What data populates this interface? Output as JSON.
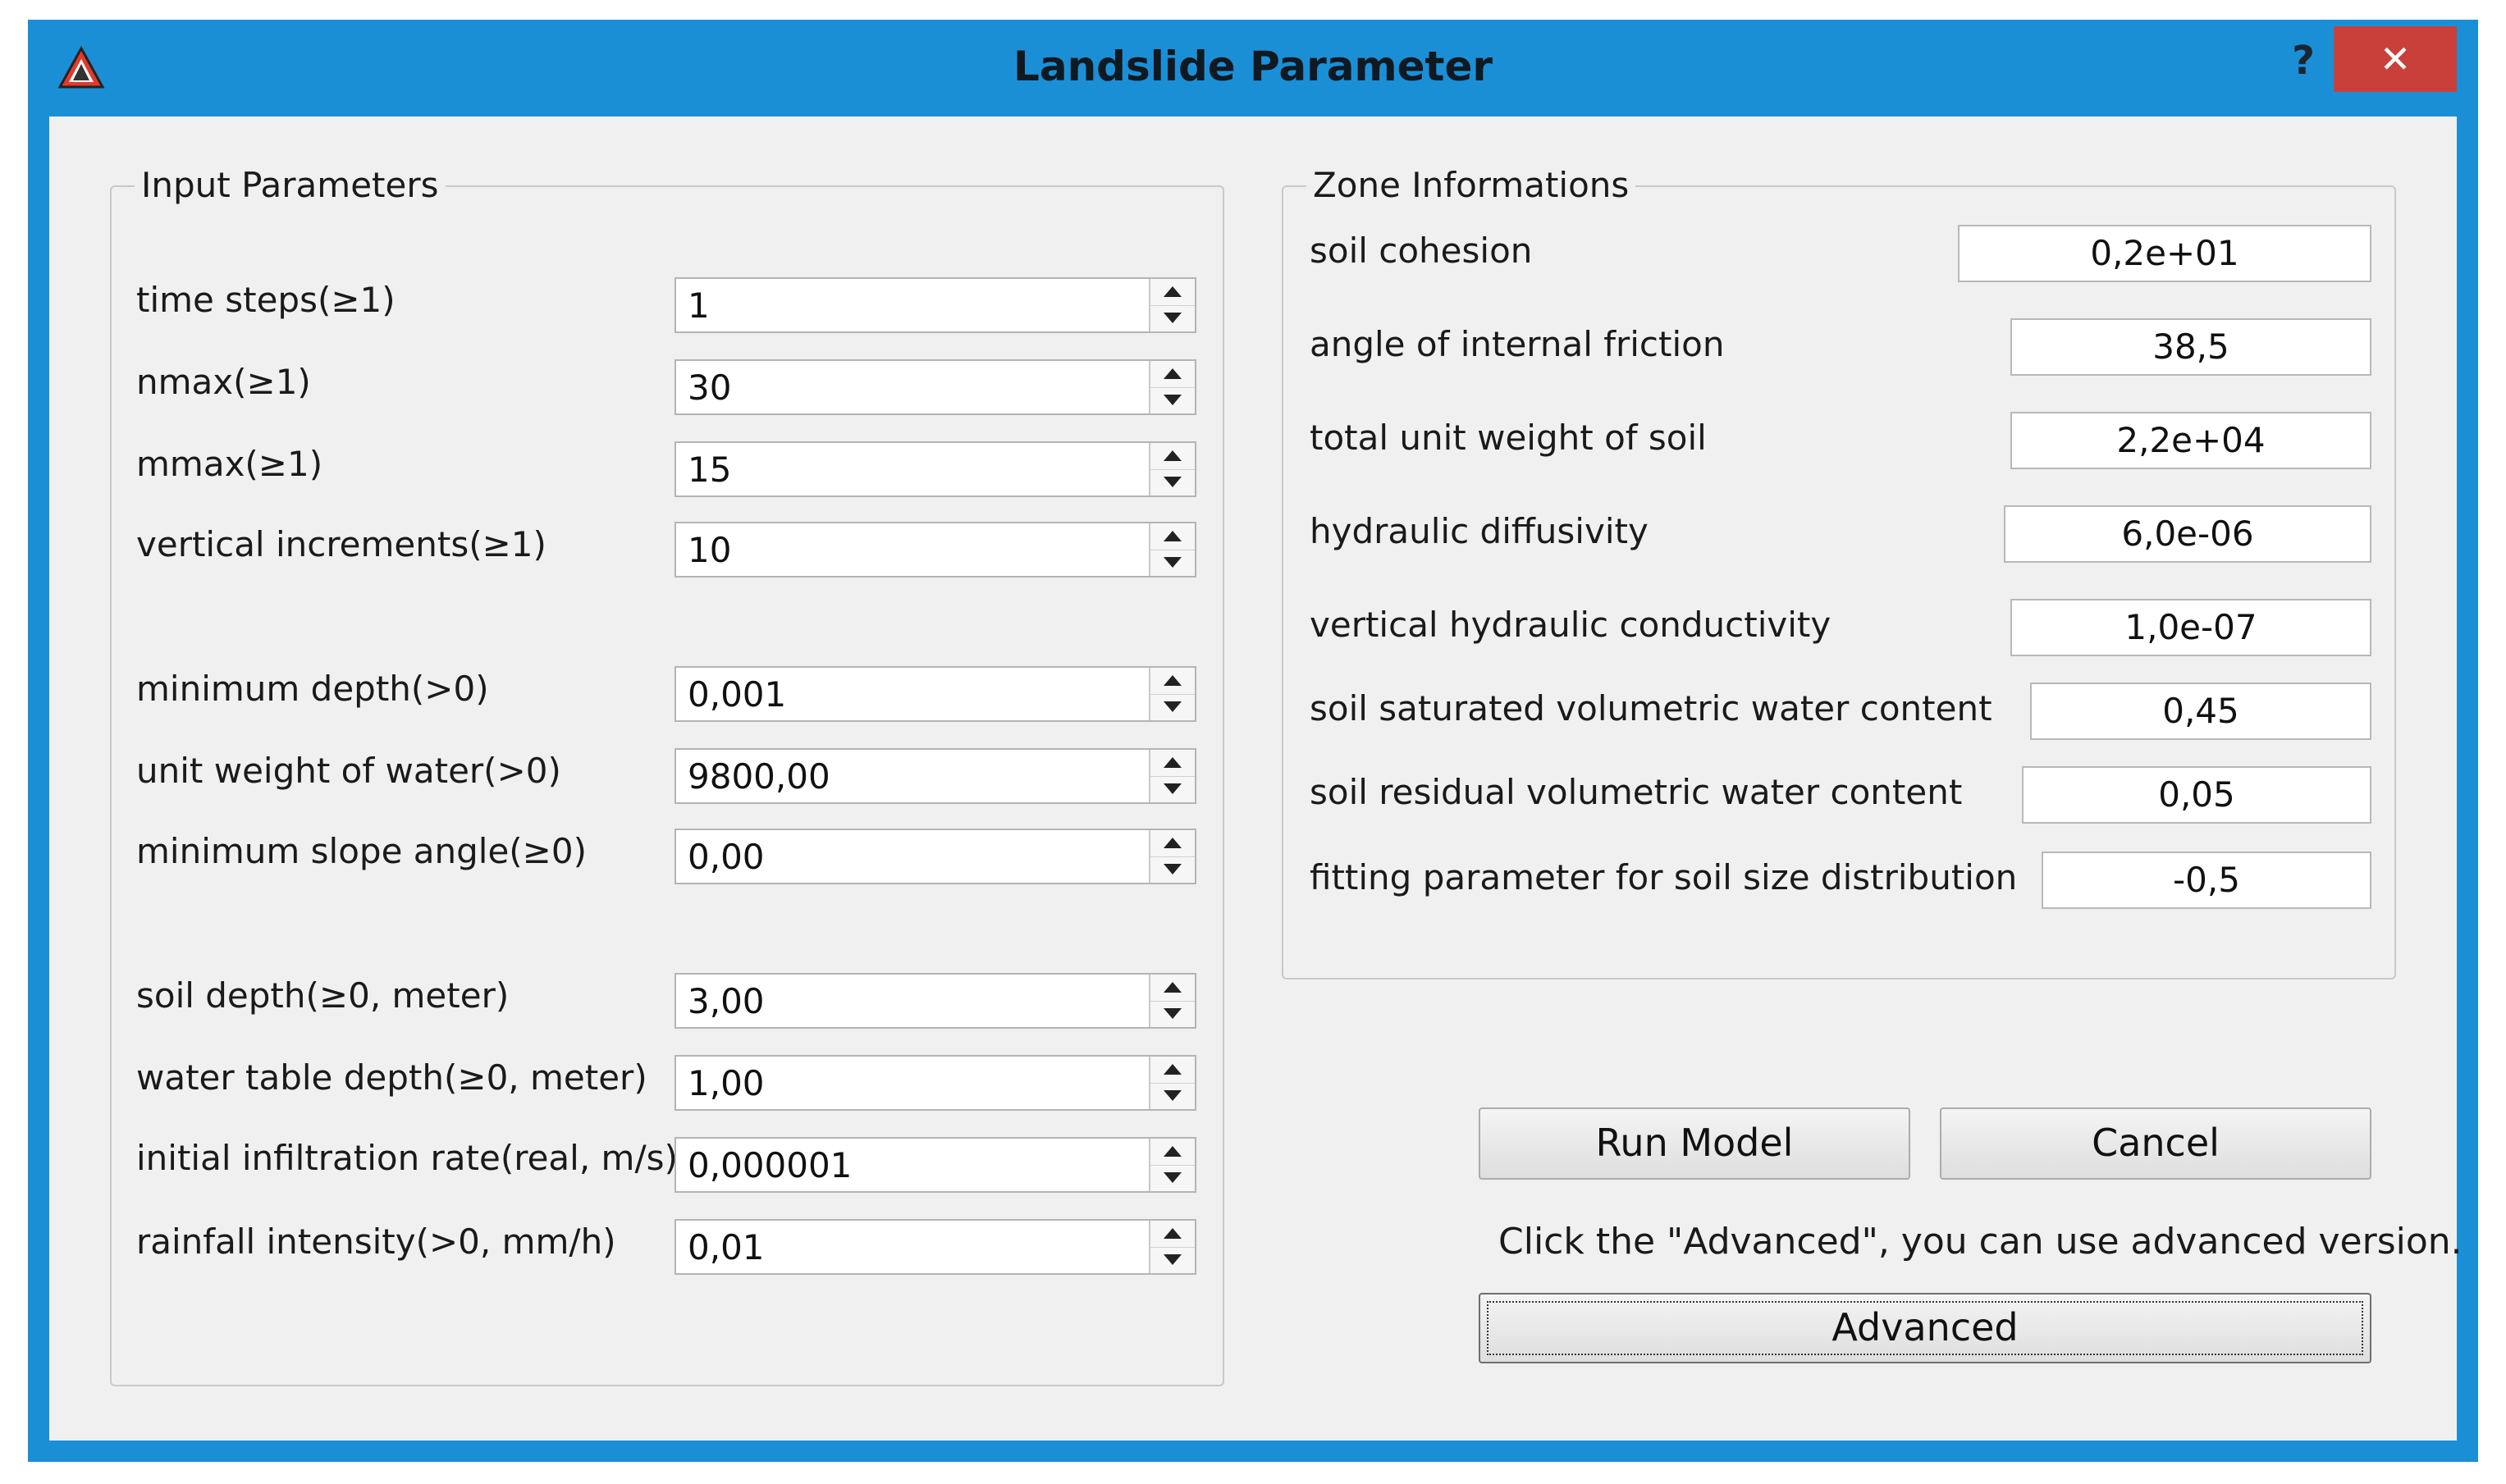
{
  "window": {
    "title": "Landslide Parameter",
    "help_label": "?",
    "close_label": "✕",
    "app_icon": "warning-triangle-icon",
    "accent_color": "#1b8fd6",
    "close_color": "#c9403a"
  },
  "input_parameters": {
    "group_title": "Input Parameters",
    "fields": [
      {
        "label": "time steps(≥1)",
        "value": "1"
      },
      {
        "label": "nmax(≥1)",
        "value": "30"
      },
      {
        "label": "mmax(≥1)",
        "value": "15"
      },
      {
        "label": "vertical increments(≥1)",
        "value": "10"
      },
      {
        "label": "minimum depth(>0)",
        "value": "0,001"
      },
      {
        "label": "unit weight of water(>0)",
        "value": "9800,00"
      },
      {
        "label": "minimum slope angle(≥0)",
        "value": "0,00"
      },
      {
        "label": "soil depth(≥0, meter)",
        "value": "3,00"
      },
      {
        "label": "water table depth(≥0, meter)",
        "value": "1,00"
      },
      {
        "label": "initial infiltration rate(real, m/s)",
        "value": "0,000001"
      },
      {
        "label": "rainfall intensity(>0, mm/h)",
        "value": "0,01"
      }
    ]
  },
  "zone_informations": {
    "group_title": "Zone Informations",
    "fields": [
      {
        "label": "soil cohesion",
        "value": "0,2e+01"
      },
      {
        "label": "angle of internal friction",
        "value": "38,5"
      },
      {
        "label": "total unit weight of soil",
        "value": "2,2e+04"
      },
      {
        "label": "hydraulic diffusivity",
        "value": "6,0e-06"
      },
      {
        "label": "vertical hydraulic conductivity",
        "value": "1,0e-07"
      },
      {
        "label": "soil saturated volumetric water content",
        "value": "0,45"
      },
      {
        "label": "soil residual volumetric water content",
        "value": "0,05"
      },
      {
        "label": "fitting parameter for soil size distribution",
        "value": "-0,5"
      }
    ]
  },
  "actions": {
    "run_label": "Run Model",
    "cancel_label": "Cancel",
    "advanced_hint": "Click the \"Advanced\", you can use advanced version.",
    "advanced_label": "Advanced"
  }
}
